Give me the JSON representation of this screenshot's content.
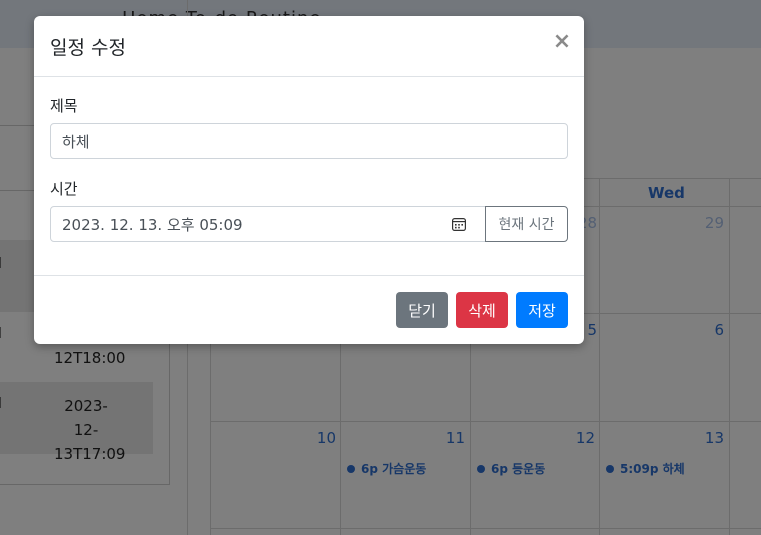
{
  "colors": {
    "primary": "#007bff",
    "danger": "#dc3545",
    "secondary": "#6c757d",
    "calendar_accent": "#2f6fd1"
  },
  "background": {
    "nav_text": "Home   To-do   Routine",
    "left_rows": [
      {
        "mark": "l",
        "text": ""
      },
      {
        "mark": "l",
        "text": "12T18:00"
      },
      {
        "mark": "l",
        "text": "2023-12-13T17:09"
      }
    ],
    "calendar": {
      "header_wed": "Wed",
      "week1": [
        "28",
        "29"
      ],
      "week2": [
        "5",
        "6"
      ],
      "week3": [
        "10",
        "11",
        "12",
        "13"
      ],
      "events": [
        {
          "day": "11",
          "label": "6p 가슴운동"
        },
        {
          "day": "12",
          "label": "6p 등운동"
        },
        {
          "day": "13",
          "label": "5:09p 하체"
        }
      ]
    }
  },
  "modal": {
    "title": "일정 수정",
    "close_icon": "close-icon",
    "fields": {
      "title_label": "제목",
      "title_value": "하체",
      "time_label": "시간",
      "time_value": "2023. 12. 13. 오후 05:09",
      "time_icon": "calendar-icon",
      "now_button": "현재 시간"
    },
    "footer": {
      "close_button": "닫기",
      "delete_button": "삭제",
      "save_button": "저장"
    }
  }
}
